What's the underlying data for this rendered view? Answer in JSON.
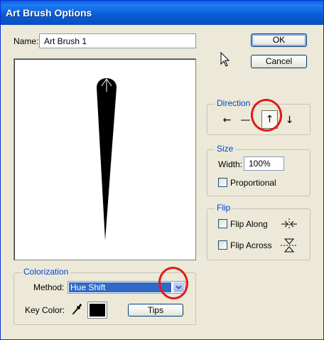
{
  "window": {
    "title": "Art Brush Options"
  },
  "name_field": {
    "label": "Name:",
    "value": "Art Brush 1"
  },
  "buttons": {
    "ok": "OK",
    "cancel": "Cancel",
    "tips": "Tips"
  },
  "direction": {
    "legend": "Direction",
    "options": [
      {
        "icon": "arrow-left-icon",
        "glyph": "←",
        "selected": false
      },
      {
        "icon": "arrow-right-icon",
        "glyph": "—",
        "selected": false
      },
      {
        "icon": "arrow-up-icon",
        "glyph": "↑",
        "selected": true
      },
      {
        "icon": "arrow-down-icon",
        "glyph": "↓",
        "selected": false
      }
    ]
  },
  "size": {
    "legend": "Size",
    "width_label": "Width:",
    "width_value": "100%",
    "proportional_label": "Proportional",
    "proportional_checked": false
  },
  "flip": {
    "legend": "Flip",
    "along_label": "Flip Along",
    "along_checked": false,
    "across_label": "Flip Across",
    "across_checked": false
  },
  "colorization": {
    "legend": "Colorization",
    "method_label": "Method:",
    "method_value": "Hue Shift",
    "key_color_label": "Key Color:",
    "key_color": "#000000"
  },
  "colors": {
    "titlebar": "#0a5bd3",
    "dialog_bg": "#ece9d8",
    "group_legend": "#0046d5",
    "selection": "#316ac5",
    "annotation": "#e21a1a"
  }
}
